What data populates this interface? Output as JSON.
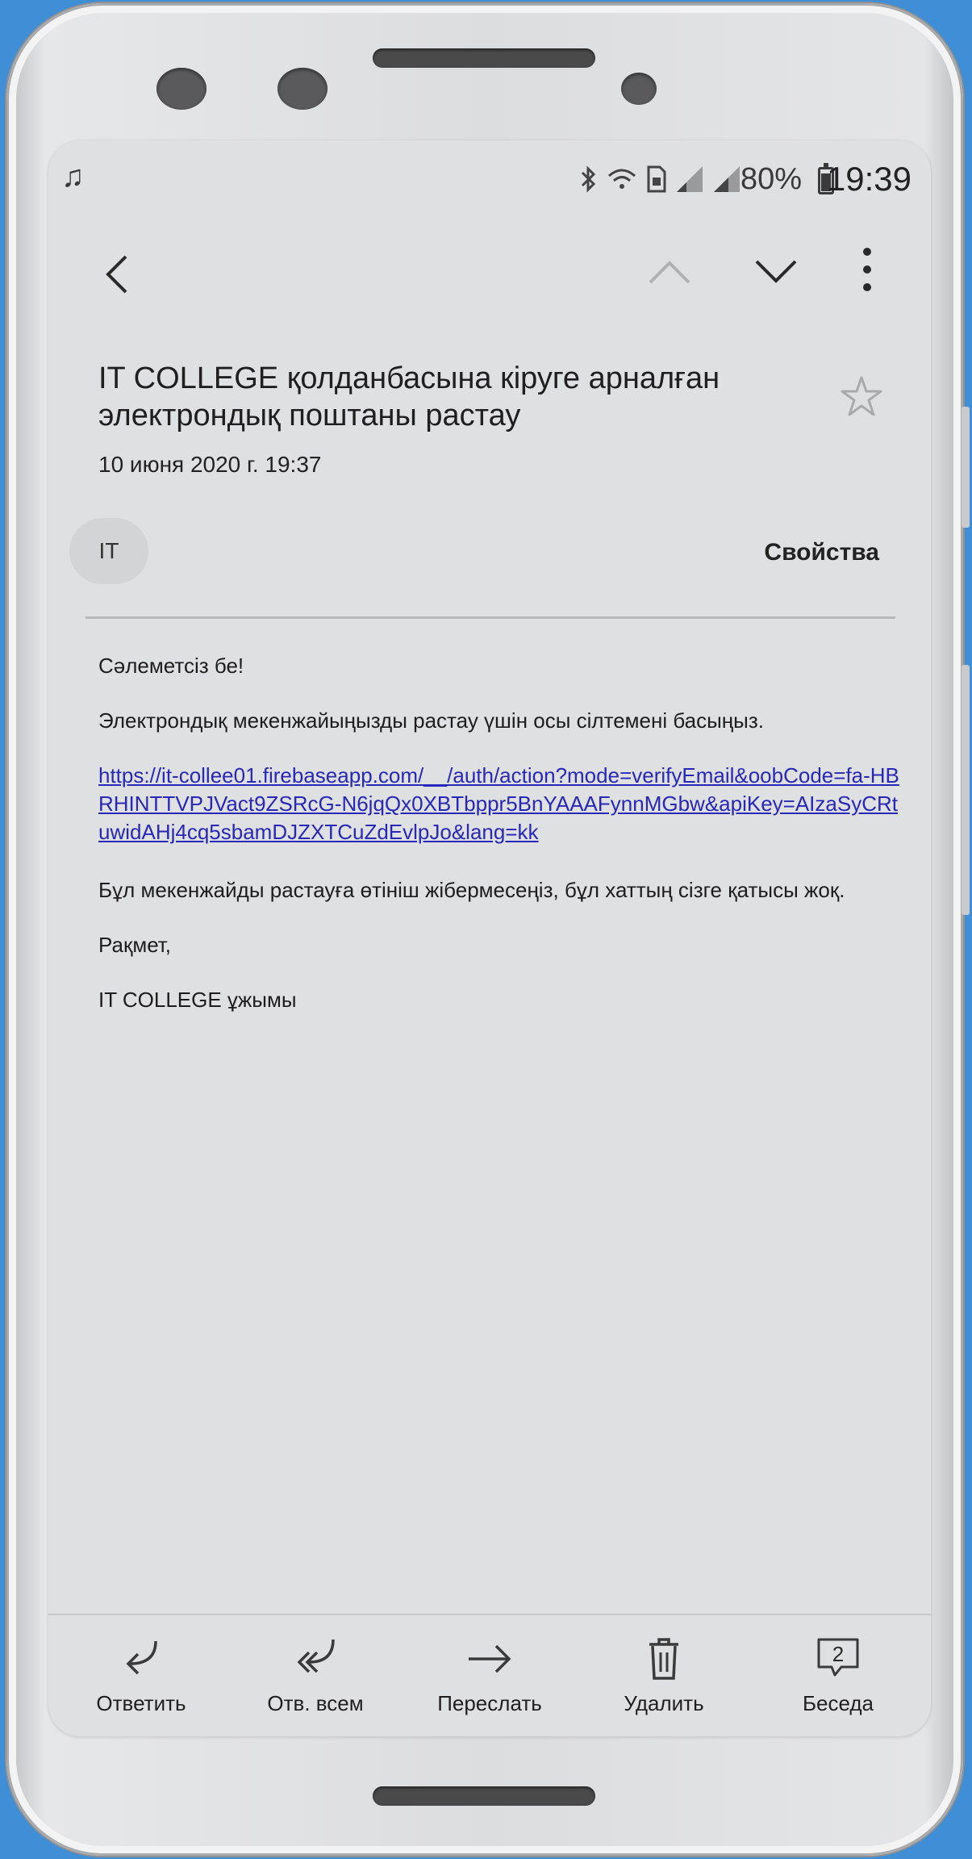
{
  "status_bar": {
    "battery_percent": "80%",
    "time": "19:39",
    "icons": [
      "music-icon",
      "bluetooth-icon",
      "wifi-icon",
      "sim-icon",
      "signal-icon",
      "signal-icon",
      "battery-icon"
    ]
  },
  "toolbar": {
    "icons": [
      "back-arrow-icon",
      "chevron-up-icon",
      "chevron-down-icon",
      "more-vertical-icon"
    ]
  },
  "email": {
    "subject": "IT COLLEGE қолданбасына кіруге арналған электрондық поштаны растау",
    "date": "10 июня 2020 г.  19:37",
    "sender_initials": "IT",
    "properties_label": "Свойства",
    "greeting": "Сәлеметсіз бе!",
    "instruction": "Электрондық мекенжайыңызды растау үшін осы сілтемені басыңыз.",
    "link": "https://it-collee01.firebaseapp.com/__/auth/action?mode=verifyEmail&oobCode=fa-HBRHINTTVPJVact9ZSRcG-N6jqQx0XBTbppr5BnYAAAFynnMGbw&apiKey=AIzaSyCRtuwidAHj4cq5sbamDJZXTCuZdEvlpJo&lang=kk",
    "disclaimer": "Бұл мекенжайды растауға өтініш жібермесеңіз, бұл хаттың сізге қатысы жоқ.",
    "thanks": "Рақмет,",
    "signature": "IT COLLEGE ұжымы"
  },
  "bottom_actions": [
    {
      "label": "Ответить",
      "icon": "reply-icon"
    },
    {
      "label": "Отв. всем",
      "icon": "reply-all-icon"
    },
    {
      "label": "Переслать",
      "icon": "forward-icon"
    },
    {
      "label": "Удалить",
      "icon": "trash-icon"
    },
    {
      "label": "Беседа",
      "icon": "conversation-icon",
      "badge": "2"
    }
  ],
  "colors": {
    "background": "#3f8ed6",
    "screen": "#dfe0e1",
    "link": "#2727b8"
  }
}
